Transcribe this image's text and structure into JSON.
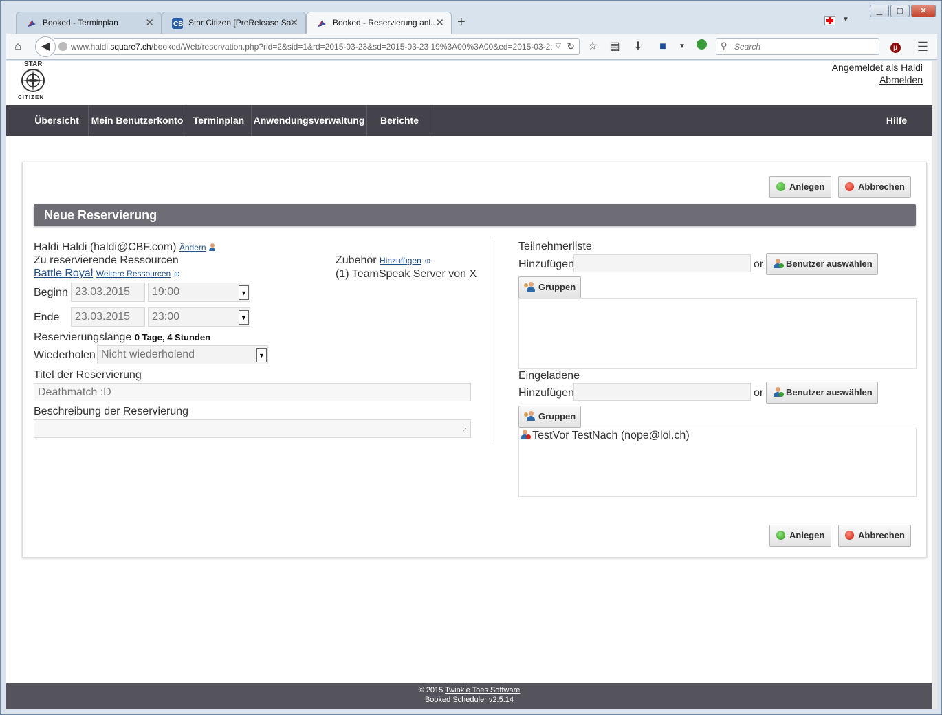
{
  "browser": {
    "tabs": [
      {
        "title": "Booked - Terminplan",
        "active": false
      },
      {
        "title": "Star Citizen [PreRelease Sa...",
        "active": false
      },
      {
        "title": "Booked - Reservierung anl...",
        "active": true
      }
    ],
    "url_prefix": "www.haldi.",
    "url_host": "square7.ch",
    "url_rest": "/booked/Web/reservation.php?rid=2&sid=1&rd=2015-03-23&sd=2015-03-23 19%3A00%3A00&ed=2015-03-2:",
    "search_placeholder": "Search"
  },
  "header": {
    "logo_top": "STAR",
    "logo_bottom": "CITIZEN",
    "logged_in": "Angemeldet als Haldi",
    "logout": "Abmelden"
  },
  "nav": {
    "items": [
      "Übersicht",
      "Mein Benutzerkonto",
      "Terminplan",
      "Anwendungsverwaltung",
      "Berichte"
    ],
    "help": "Hilfe"
  },
  "form": {
    "create_label": "Anlegen",
    "cancel_label": "Abbrechen",
    "section_title": "Neue Reservierung",
    "owner": "Haldi Haldi (haldi@CBF.com)",
    "change_link": "Ändern",
    "resources_label": "Zu reservierende Ressourcen",
    "resource_name": "Battle Royal",
    "more_resources": "Weitere Ressourcen",
    "accessories_label": "Zubehör",
    "accessories_add": "Hinzufügen",
    "accessory_item": "(1) TeamSpeak Server von X",
    "begin_label": "Beginn",
    "begin_date": "23.03.2015",
    "begin_time": "19:00",
    "end_label": "Ende",
    "end_date": "23.03.2015",
    "end_time": "23:00",
    "length_label": "Reservierungslänge",
    "length_value": "0 Tage, 4 Stunden",
    "repeat_label": "Wiederholen",
    "repeat_value": "Nicht wiederholend",
    "title_label": "Titel der Reservierung",
    "title_value": "Deathmatch :D",
    "description_label": "Beschreibung der Reservierung"
  },
  "participants": {
    "title": "Teilnehmerliste",
    "add_label": "Hinzufügen",
    "or": "or",
    "select_users": "Benutzer auswählen",
    "groups": "Gruppen"
  },
  "invitees": {
    "title": "Eingeladene",
    "add_label": "Hinzufügen",
    "or": "or",
    "select_users": "Benutzer auswählen",
    "groups": "Gruppen",
    "list": [
      "TestVor TestNach (nope@lol.ch)"
    ]
  },
  "footer": {
    "copyright": "© 2015",
    "company": "Twinkle Toes Software",
    "version": "Booked Scheduler v2.5.14"
  }
}
